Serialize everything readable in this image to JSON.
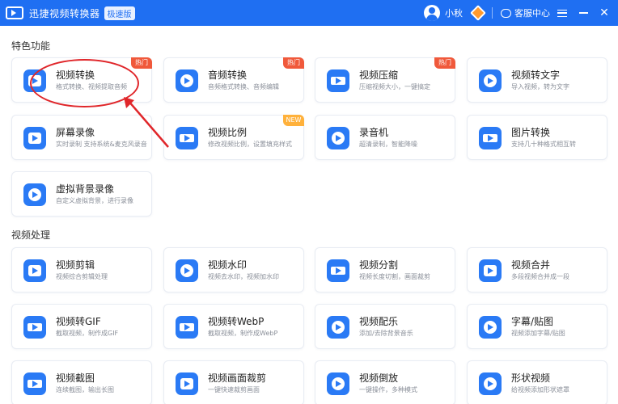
{
  "titlebar": {
    "app_title": "迅捷视频转换器",
    "edition_badge": "极速版",
    "username": "小秋",
    "customer_service": "客服中心"
  },
  "colors": {
    "titlebar_bg": "#1f6ff2",
    "hot_badge": "#f0593b",
    "new_badge": "#ffb13b",
    "annotation": "#e0262a"
  },
  "sections": {
    "featured": {
      "title": "特色功能",
      "cards": [
        {
          "name": "视频转换",
          "desc": "格式转换、视频提取音频",
          "badge": "热门",
          "icon": "video-convert-icon"
        },
        {
          "name": "音频转换",
          "desc": "音频格式转换、音频编辑",
          "badge": "热门",
          "icon": "audio-convert-icon"
        },
        {
          "name": "视频压缩",
          "desc": "压缩视频大小，一键搞定",
          "badge": "热门",
          "icon": "video-compress-icon"
        },
        {
          "name": "视频转文字",
          "desc": "导入视频，转为文字",
          "badge": "",
          "icon": "video-to-text-icon"
        },
        {
          "name": "屏幕录像",
          "desc": "实时录制 支持系统&麦克风录音",
          "badge": "",
          "icon": "screen-record-icon"
        },
        {
          "name": "视频比例",
          "desc": "修改视频比例，设置填充样式",
          "badge": "NEW",
          "icon": "video-ratio-icon"
        },
        {
          "name": "录音机",
          "desc": "超清录制，智能降噪",
          "badge": "",
          "icon": "recorder-icon"
        },
        {
          "name": "图片转换",
          "desc": "支持几十种格式相互转",
          "badge": "",
          "icon": "image-convert-icon"
        },
        {
          "name": "虚拟背景录像",
          "desc": "自定义虚拟背景，进行录像",
          "badge": "",
          "icon": "virtual-bg-icon"
        }
      ]
    },
    "processing": {
      "title": "视频处理",
      "cards": [
        {
          "name": "视频剪辑",
          "desc": "视频综合剪辑处理",
          "icon": "video-edit-icon"
        },
        {
          "name": "视频水印",
          "desc": "视频去水印，视频加水印",
          "icon": "watermark-icon"
        },
        {
          "name": "视频分割",
          "desc": "视频长度切割，画面裁剪",
          "icon": "video-split-icon"
        },
        {
          "name": "视频合并",
          "desc": "多段视频合并成一段",
          "icon": "video-merge-icon"
        },
        {
          "name": "视频转GIF",
          "desc": "截取视频，制作成GIF",
          "icon": "gif-icon"
        },
        {
          "name": "视频转WebP",
          "desc": "截取视频，制作成WebP",
          "icon": "webp-icon"
        },
        {
          "name": "视频配乐",
          "desc": "添加/去除背景音乐",
          "icon": "music-icon"
        },
        {
          "name": "字幕/贴图",
          "desc": "视频添加字幕/贴图",
          "icon": "subtitle-icon"
        },
        {
          "name": "视频截图",
          "desc": "连续截图，输出长图",
          "icon": "screenshot-icon"
        },
        {
          "name": "视频画面裁剪",
          "desc": "一键快速裁剪画面",
          "icon": "crop-icon"
        },
        {
          "name": "视频倒放",
          "desc": "一键操作，多种模式",
          "icon": "reverse-icon"
        },
        {
          "name": "形状视频",
          "desc": "给视频添加形状遮罩",
          "icon": "shape-icon"
        }
      ]
    }
  }
}
